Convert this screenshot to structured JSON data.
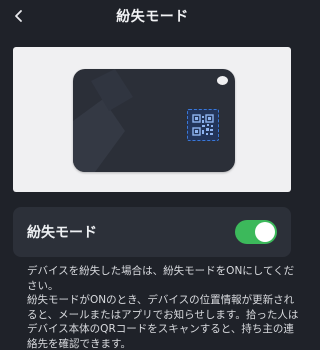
{
  "header": {
    "title": "紛失モード",
    "back_icon": "chevron-left-icon"
  },
  "preview": {
    "tag_icon": "tag-device-icon",
    "qr_icon": "qr-code-icon"
  },
  "lost_mode": {
    "label": "紛失モード",
    "enabled": true,
    "toggle_color": "#3cb95b"
  },
  "description": {
    "lines": [
      "デバイスを紛失した場合は、紛失モードをONにしてください。",
      "紛失モードがONのとき、デバイスの位置情報が更新されると、メールまたはアプリでお知らせします。拾った人はデバイス本体のQRコードをスキャンすると、持ち主の連絡先を確認できます。"
    ]
  },
  "colors": {
    "background": "#1f2229",
    "card": "#2c3039",
    "preview_bg": "#f0f0f2",
    "accent_blue": "#3a78d8"
  }
}
